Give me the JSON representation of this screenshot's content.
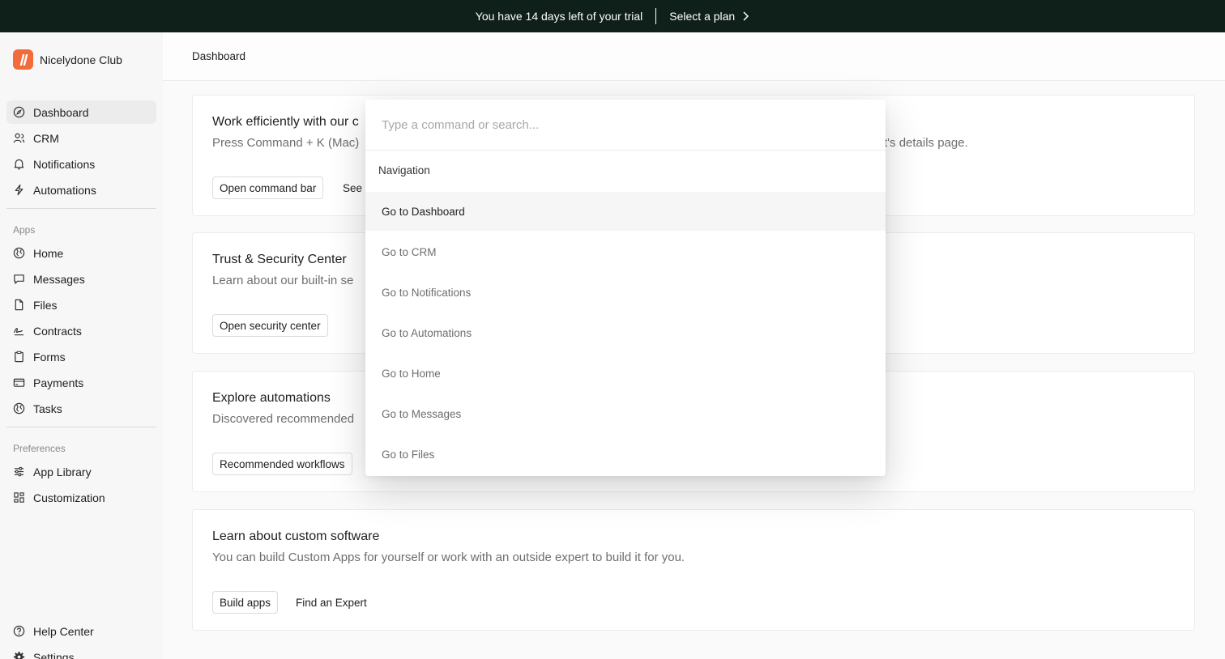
{
  "banner": {
    "trial_text": "You have 14 days left of your trial",
    "cta": "Select a plan"
  },
  "brand": {
    "name": "Nicelydone Club",
    "accent": "#f26b3a"
  },
  "sidebar": {
    "main_items": [
      {
        "label": "Dashboard",
        "icon": "compass-icon"
      },
      {
        "label": "CRM",
        "icon": "users-icon"
      },
      {
        "label": "Notifications",
        "icon": "bell-icon"
      },
      {
        "label": "Automations",
        "icon": "bolt-icon"
      }
    ],
    "apps_label": "Apps",
    "apps": [
      {
        "label": "Home",
        "icon": "globe-icon"
      },
      {
        "label": "Messages",
        "icon": "chat-icon"
      },
      {
        "label": "Files",
        "icon": "file-icon"
      },
      {
        "label": "Contracts",
        "icon": "signature-icon"
      },
      {
        "label": "Forms",
        "icon": "clipboard-icon"
      },
      {
        "label": "Payments",
        "icon": "credit-card-icon"
      },
      {
        "label": "Tasks",
        "icon": "globe-icon"
      }
    ],
    "preferences_label": "Preferences",
    "preferences": [
      {
        "label": "App Library",
        "icon": "sliders-icon"
      },
      {
        "label": "Customization",
        "icon": "grid-icon"
      }
    ],
    "footer": [
      {
        "label": "Help Center",
        "icon": "help-icon"
      },
      {
        "label": "Settings",
        "icon": "gear-icon"
      }
    ]
  },
  "header": {
    "title": "Dashboard"
  },
  "cards": [
    {
      "title": "Work efficiently with our c",
      "desc": "Press Command + K (Mac)",
      "desc_right": "t's details page.",
      "button": "Open command bar",
      "link": "See"
    },
    {
      "title": "Trust & Security Center",
      "desc": "Learn about our built-in se",
      "button": "Open security center"
    },
    {
      "title": "Explore automations",
      "desc": "Discovered recommended",
      "button": "Recommended workflows"
    },
    {
      "title": "Learn about custom software",
      "desc": "You can build Custom Apps for yourself or work with an outside expert to build it for you.",
      "button": "Build apps",
      "link": "Find an Expert"
    }
  ],
  "palette": {
    "placeholder": "Type a command or search...",
    "group": "Navigation",
    "items": [
      "Go to Dashboard",
      "Go to CRM",
      "Go to Notifications",
      "Go to Automations",
      "Go to Home",
      "Go to Messages",
      "Go to Files"
    ]
  }
}
